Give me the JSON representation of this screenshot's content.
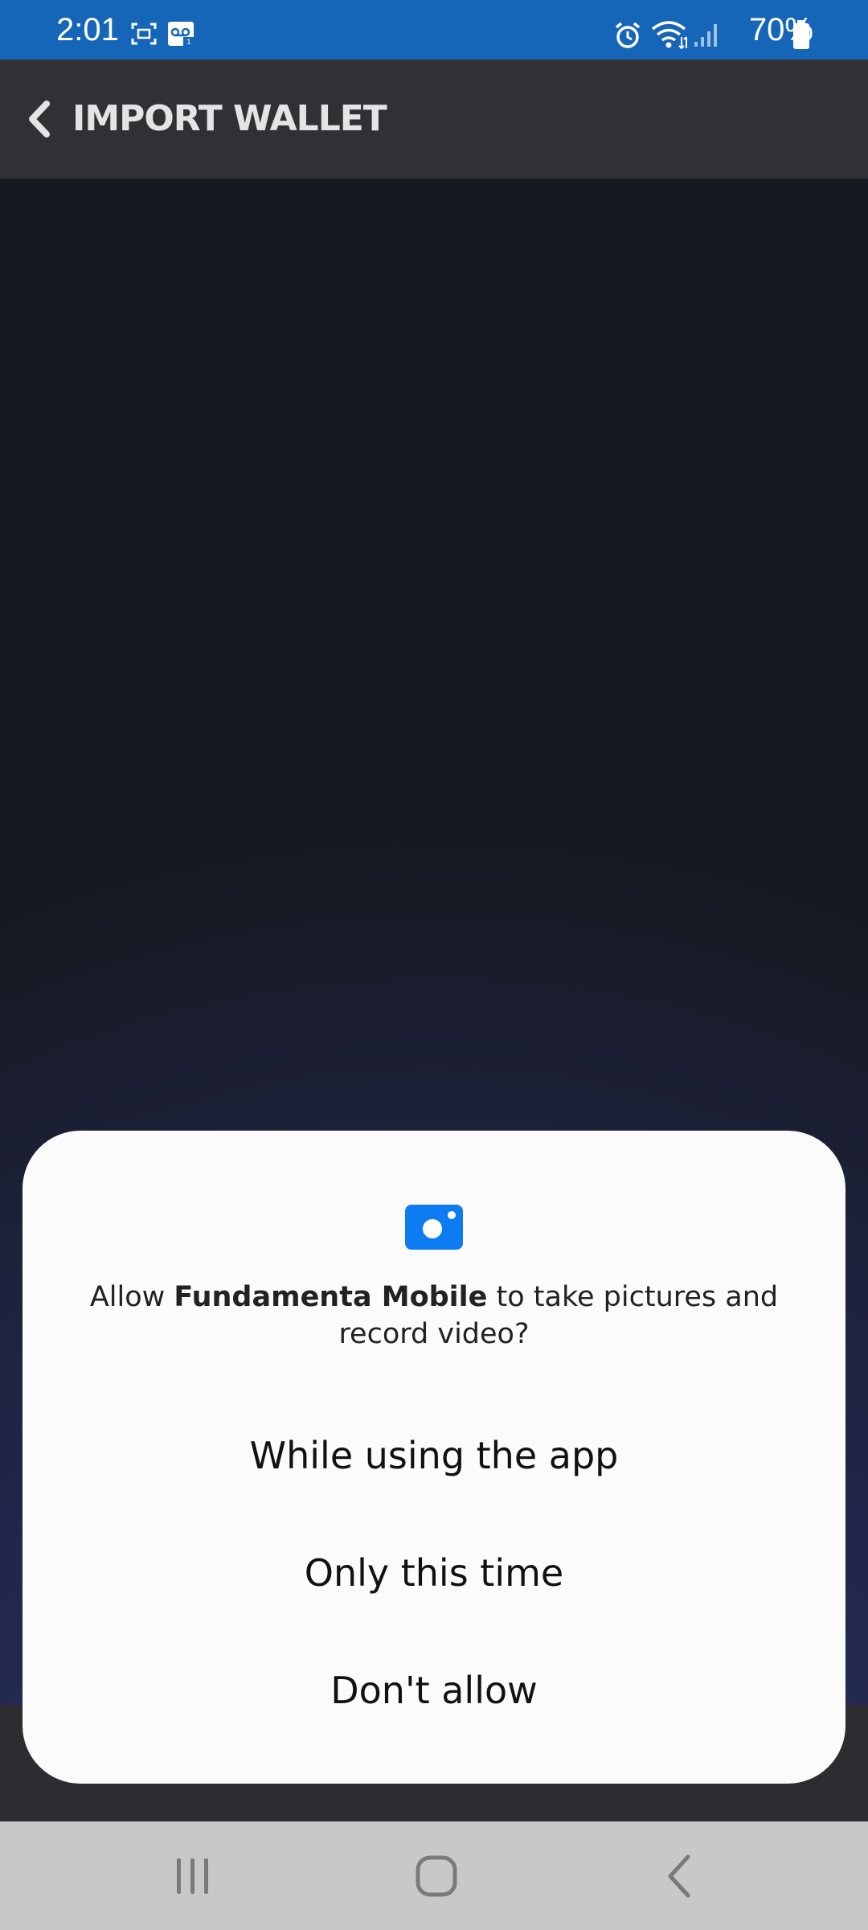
{
  "status_bar": {
    "time": "2:01",
    "battery": "70%",
    "icons": [
      "screenshot-icon",
      "voicemail-icon",
      "alarm-icon",
      "wifi-icon",
      "signal-icon",
      "battery-icon"
    ],
    "background_color": "#1565b8"
  },
  "header": {
    "title": "IMPORT WALLET",
    "back_icon": "chevron-left-icon",
    "background_color": "#303035"
  },
  "permission_dialog": {
    "icon": "camera-icon",
    "icon_color": "#0d7cf2",
    "message_prefix": "Allow ",
    "app_name": "Fundamenta Mobile",
    "message_suffix": " to take pictures and record video?",
    "options": [
      {
        "label": "While using the app"
      },
      {
        "label": "Only this time"
      },
      {
        "label": "Don't allow"
      }
    ]
  },
  "nav_bar": {
    "buttons": [
      "recent-apps-icon",
      "home-icon",
      "back-icon"
    ],
    "background_color": "#c8c8c8"
  }
}
